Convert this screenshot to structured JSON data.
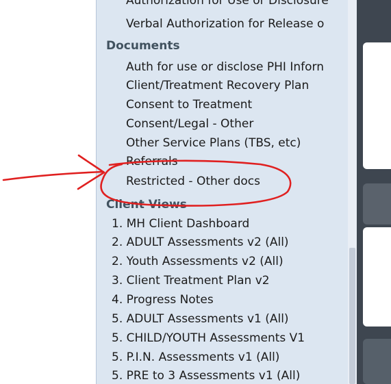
{
  "sidebar": {
    "top_items": [
      "Authorization for Use or Disclosure",
      "Verbal Authorization for Release o"
    ],
    "documents_header": "Documents",
    "documents_items": [
      "Auth for use or disclose PHI Inforn",
      "Client/Treatment Recovery Plan",
      "Consent to Treatment",
      "Consent/Legal - Other",
      "Other Service Plans (TBS, etc)",
      "Referrals",
      "Restricted - Other docs"
    ],
    "client_views_header": "Client Views",
    "client_views_items": [
      "1. MH Client Dashboard",
      "2. ADULT Assessments v2 (All)",
      "2. Youth Assessments v2 (All)",
      "3. Client Treatment Plan v2",
      "4. Progress Notes",
      "5. ADULT Assessments v1 (All)",
      "5. CHILD/YOUTH Assessments V1",
      "5. P.I.N. Assessments v1 (All)",
      "5. PRE to 3 Assessments v1 (All)"
    ]
  },
  "annotation": {
    "color": "#e02020",
    "target": "Restricted - Other docs"
  }
}
